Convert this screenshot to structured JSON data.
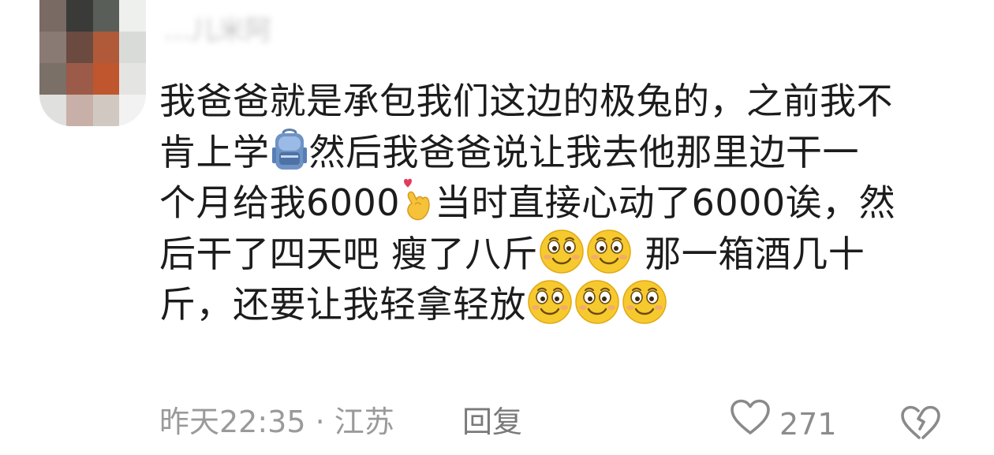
{
  "comment": {
    "username": "…儿米阿",
    "avatar_colors": [
      "#7a6a64",
      "#3a3a38",
      "#5a5e58",
      "#eef0ee",
      "#8a7a74",
      "#6b4a40",
      "#b05a3a",
      "#d9dbd8",
      "#7a7068",
      "#9c5a48",
      "#c0562e",
      "#e4e4e2",
      "#e0e0de",
      "#c8b0a8",
      "#d2c8c2",
      "#f2f2f2"
    ],
    "lines": [
      [
        {
          "t": "text",
          "v": "我爸爸就是承包我们这边的极兔的，之前我不"
        }
      ],
      [
        {
          "t": "text",
          "v": "肯上学"
        },
        {
          "t": "emoji",
          "v": "backpack-emoji"
        },
        {
          "t": "text",
          "v": "然后我爸爸说让我去他那里边干一"
        }
      ],
      [
        {
          "t": "text",
          "v": "个月给我6000"
        },
        {
          "t": "emoji",
          "v": "finger-heart-emoji"
        },
        {
          "t": "text",
          "v": "当时直接心动了6000诶，然"
        }
      ],
      [
        {
          "t": "text",
          "v": "后干了四天吧  瘦了八斤"
        },
        {
          "t": "emoji",
          "v": "smile-emoji"
        },
        {
          "t": "emoji",
          "v": "smile-emoji"
        },
        {
          "t": "text",
          "v": " 那一箱酒几十"
        }
      ],
      [
        {
          "t": "text",
          "v": "斤，还要让我轻拿轻放"
        },
        {
          "t": "emoji",
          "v": "smile-emoji"
        },
        {
          "t": "emoji",
          "v": "smile-emoji"
        },
        {
          "t": "emoji",
          "v": "smile-emoji"
        }
      ]
    ],
    "time": "昨天22:35",
    "separator": " · ",
    "location": "江苏",
    "reply_label": "回复",
    "like_count": "271",
    "like_icon": "heart-outline-icon",
    "dislike_icon": "broken-heart-icon"
  }
}
